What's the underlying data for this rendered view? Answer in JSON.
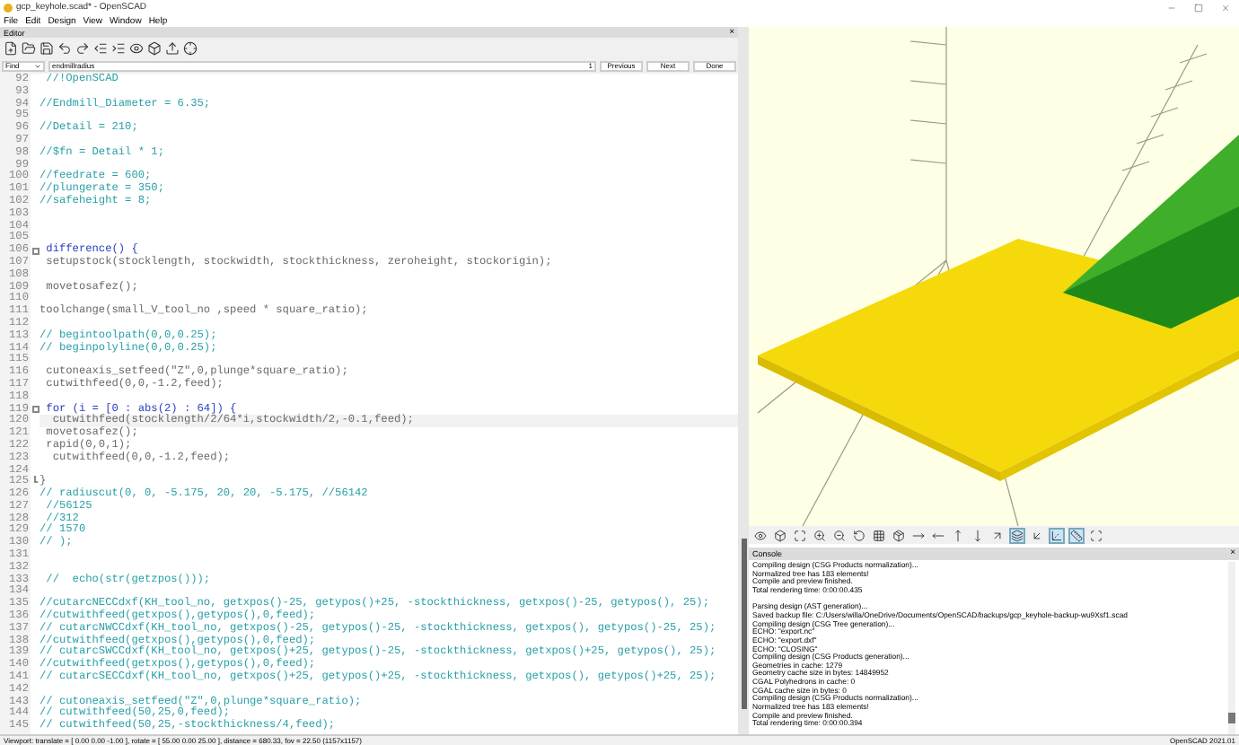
{
  "window": {
    "title": "gcp_keyhole.scad* - OpenSCAD"
  },
  "menu": [
    "File",
    "Edit",
    "Design",
    "View",
    "Window",
    "Help"
  ],
  "editor": {
    "title": "Editor",
    "close": "×",
    "find": {
      "mode": "Find",
      "value": "endmillradius",
      "count": "1",
      "buttons": [
        "Previous",
        "Next",
        "Done"
      ]
    },
    "lines": [
      {
        "number": "92",
        "kind": "comment",
        "text": " //!OpenSCAD"
      },
      {
        "number": "93",
        "kind": "blank"
      },
      {
        "number": "94",
        "kind": "comment",
        "text": "//Endmill_Diameter = 6.35;"
      },
      {
        "number": "95",
        "kind": "blank"
      },
      {
        "number": "96",
        "kind": "comment",
        "text": "//Detail = 210;"
      },
      {
        "number": "97",
        "kind": "blank"
      },
      {
        "number": "98",
        "kind": "comment",
        "text": "//$fn = Detail * 1;"
      },
      {
        "number": "99",
        "kind": "blank"
      },
      {
        "number": "100",
        "kind": "comment",
        "text": "//feedrate = 600;"
      },
      {
        "number": "101",
        "kind": "comment",
        "text": "//plungerate = 350;"
      },
      {
        "number": "102",
        "kind": "comment",
        "text": "//safeheight = 8;"
      },
      {
        "number": "103",
        "kind": "blank"
      },
      {
        "number": "104",
        "kind": "blank"
      },
      {
        "number": "105",
        "kind": "blank"
      },
      {
        "number": "106",
        "kind": "block_start",
        "text": " difference() {"
      },
      {
        "number": "107",
        "kind": "code",
        "text": " setupstock(stocklength, stockwidth, stockthickness, zeroheight, stockorigin);"
      },
      {
        "number": "108",
        "kind": "blank"
      },
      {
        "number": "109",
        "kind": "code",
        "text": " movetosafez();"
      },
      {
        "number": "110",
        "kind": "blank"
      },
      {
        "number": "111",
        "kind": "code",
        "text": "toolchange(small_V_tool_no ,speed * square_ratio);"
      },
      {
        "number": "112",
        "kind": "blank"
      },
      {
        "number": "113",
        "kind": "comment",
        "text": "// begintoolpath(0,0,0.25);"
      },
      {
        "number": "114",
        "kind": "comment",
        "text": "// beginpolyline(0,0,0.25);"
      },
      {
        "number": "115",
        "kind": "blank"
      },
      {
        "number": "116",
        "kind": "code",
        "text": " cutoneaxis_setfeed(\"Z\",0,plunge*square_ratio);"
      },
      {
        "number": "117",
        "kind": "code",
        "text": " cutwithfeed(0,0,-1.2,feed);"
      },
      {
        "number": "118",
        "kind": "blank"
      },
      {
        "number": "119",
        "kind": "block_start",
        "text": " for (i = [0 : abs(2) : 64]) {"
      },
      {
        "number": "120",
        "kind": "current",
        "text": "  cutwithfeed(stocklength/2/64*i,stockwidth/2,-0.1,feed);"
      },
      {
        "number": "121",
        "kind": "code",
        "text": " movetosafez();"
      },
      {
        "number": "122",
        "kind": "code",
        "text": " rapid(0,0,1);"
      },
      {
        "number": "123",
        "kind": "code",
        "text": "  cutwithfeed(0,0,-1.2,feed);"
      },
      {
        "number": "124",
        "kind": "blank"
      },
      {
        "number": "125",
        "kind": "block_end",
        "text": "}"
      },
      {
        "number": "126",
        "kind": "comment",
        "text": "// radiuscut(0, 0, -5.175, 20, 20, -5.175, //56142"
      },
      {
        "number": "127",
        "kind": "comment",
        "text": " //56125"
      },
      {
        "number": "128",
        "kind": "comment",
        "text": " //312"
      },
      {
        "number": "129",
        "kind": "comment",
        "text": "// 1570"
      },
      {
        "number": "130",
        "kind": "comment",
        "text": "// );"
      },
      {
        "number": "131",
        "kind": "blank"
      },
      {
        "number": "132",
        "kind": "blank"
      },
      {
        "number": "133",
        "kind": "comment",
        "text": " //  echo(str(getzpos()));"
      },
      {
        "number": "134",
        "kind": "blank"
      },
      {
        "number": "135",
        "kind": "comment",
        "text": "//cutarcNECCdxf(KH_tool_no, getxpos()-25, getypos()+25, -stockthickness, getxpos()-25, getypos(), 25);"
      },
      {
        "number": "136",
        "kind": "comment",
        "text": "//cutwithfeed(getxpos(),getypos(),0,feed);"
      },
      {
        "number": "137",
        "kind": "comment",
        "text": "// cutarcNWCCdxf(KH_tool_no, getxpos()-25, getypos()-25, -stockthickness, getxpos(), getypos()-25, 25);"
      },
      {
        "number": "138",
        "kind": "comment",
        "text": "//cutwithfeed(getxpos(),getypos(),0,feed);"
      },
      {
        "number": "139",
        "kind": "comment",
        "text": "// cutarcSWCCdxf(KH_tool_no, getxpos()+25, getypos()-25, -stockthickness, getxpos()+25, getypos(), 25);"
      },
      {
        "number": "140",
        "kind": "comment",
        "text": "//cutwithfeed(getxpos(),getypos(),0,feed);"
      },
      {
        "number": "141",
        "kind": "comment",
        "text": "// cutarcSECCdxf(KH_tool_no, getxpos()+25, getypos()+25, -stockthickness, getxpos(), getypos()+25, 25);"
      },
      {
        "number": "142",
        "kind": "blank"
      },
      {
        "number": "143",
        "kind": "comment",
        "text": "// cutoneaxis_setfeed(\"Z\",0,plunge*square_ratio);"
      },
      {
        "number": "144",
        "kind": "comment",
        "text": "// cutwithfeed(50,25,0,feed);"
      },
      {
        "number": "145",
        "kind": "comment",
        "text": "// cutwithfeed(50,25,-stockthickness/4,feed);"
      }
    ]
  },
  "viewport_toolbar": [
    {
      "selected": false
    },
    {
      "selected": false
    },
    {
      "selected": false
    },
    {
      "selected": false
    },
    {
      "selected": false
    },
    {
      "selected": false
    },
    {
      "selected": false
    },
    {
      "selected": false
    },
    {
      "selected": false
    },
    {
      "selected": false
    },
    {
      "selected": false
    },
    {
      "selected": false
    },
    {
      "selected": false
    },
    {
      "selected": true
    },
    {
      "selected": false
    },
    {
      "selected": true
    },
    {
      "selected": true
    },
    {
      "selected": false
    }
  ],
  "console": {
    "title": "Console",
    "close": "×",
    "blocks": [
      [
        "Compiling design (CSG Products normalization)...",
        "Normalized tree has 183 elements!",
        "Compile and preview finished.",
        "Total rendering time: 0:00:00.435"
      ],
      [
        "Parsing design (AST generation)...",
        "Saved backup file: C:/Users/willa/OneDrive/Documents/OpenSCAD/backups/gcp_keyhole-backup-wu9Xsf1.scad",
        "Compiling design (CSG Tree generation)...",
        "ECHO: \"export.nc\"",
        "ECHO: \"export.dxf\"",
        "ECHO: \"CLOSING\"",
        "Compiling design (CSG Products generation)...",
        "Geometries in cache: 1279",
        "Geometry cache size in bytes: 14849952",
        "CGAL Polyhedrons in cache: 0",
        "CGAL cache size in bytes: 0",
        "Compiling design (CSG Products normalization)...",
        "Normalized tree has 183 elements!",
        "Compile and preview finished.",
        "Total rendering time: 0:00:00.394"
      ]
    ]
  },
  "status_bar": {
    "viewport": "Viewport: translate = [ 0.00 0.00 -1.00 ], rotate = [ 55.00 0.00 25.00 ], distance = 680.33, fov = 22.50 (1157x1157)",
    "version": "OpenSCAD 2021.01"
  }
}
